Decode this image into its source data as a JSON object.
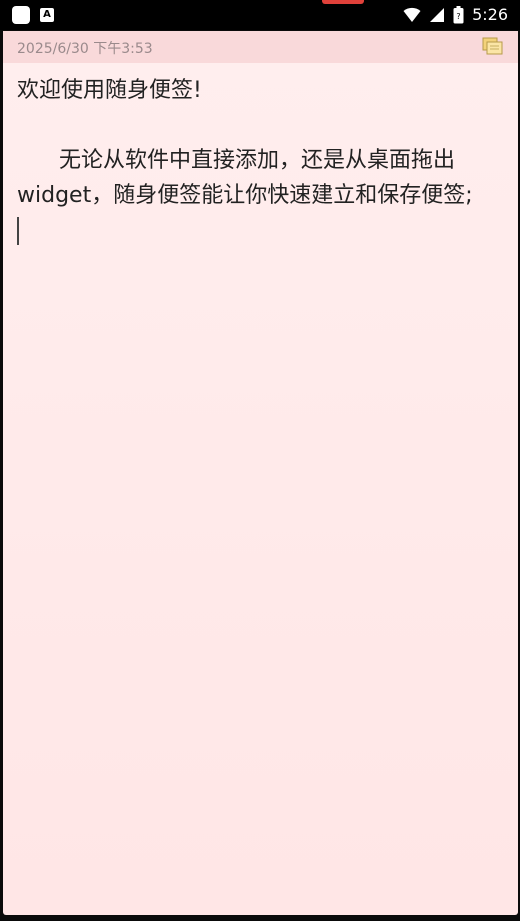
{
  "status_bar": {
    "time": "5:26",
    "left_icons": [
      "app-square-icon",
      "keyboard-a-icon"
    ],
    "right_icons": [
      "wifi-icon",
      "signal-icon",
      "battery-icon"
    ]
  },
  "note": {
    "timestamp": "2025/6/30 下午3:53",
    "header_icon": "sticky-notes-icon",
    "title_line": "欢迎使用随身便签!",
    "paragraph": "      无论从软件中直接添加，还是从桌面拖出widget，随身便签能让你快速建立和保存便签;"
  },
  "colors": {
    "note_background": "#ffeeee",
    "note_header": "#f9d9da",
    "timestamp_text": "#9a8a8c",
    "body_text": "#222222"
  }
}
